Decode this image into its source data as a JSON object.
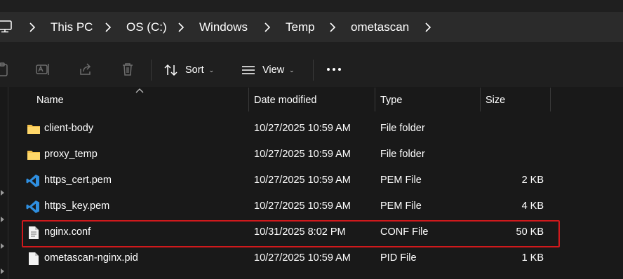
{
  "breadcrumb": {
    "icon": "this-pc-icon",
    "items": [
      "This PC",
      "OS (C:)",
      "Windows",
      "Temp",
      "ometascan"
    ]
  },
  "toolbar": {
    "sort_label": "Sort",
    "view_label": "View",
    "more_icon": "more-icon"
  },
  "columns": {
    "name": "Name",
    "date": "Date modified",
    "type": "Type",
    "size": "Size"
  },
  "files": [
    {
      "name": "client-body",
      "date": "10/27/2025 10:59 AM",
      "type": "File folder",
      "size": "",
      "icon": "folder-icon"
    },
    {
      "name": "proxy_temp",
      "date": "10/27/2025 10:59 AM",
      "type": "File folder",
      "size": "",
      "icon": "folder-icon"
    },
    {
      "name": "https_cert.pem",
      "date": "10/27/2025 10:59 AM",
      "type": "PEM File",
      "size": "2 KB",
      "icon": "vscode-file-icon"
    },
    {
      "name": "https_key.pem",
      "date": "10/27/2025 10:59 AM",
      "type": "PEM File",
      "size": "4 KB",
      "icon": "vscode-file-icon"
    },
    {
      "name": "nginx.conf",
      "date": "10/31/2025 8:02 PM",
      "type": "CONF File",
      "size": "50 KB",
      "icon": "text-file-icon"
    },
    {
      "name": "ometascan-nginx.pid",
      "date": "10/27/2025 10:59 AM",
      "type": "PID File",
      "size": "1 KB",
      "icon": "blank-file-icon"
    }
  ],
  "highlight_color": "#d0191c",
  "folder_color": "#f5c24c",
  "vscode_color": "#2f8fe0"
}
